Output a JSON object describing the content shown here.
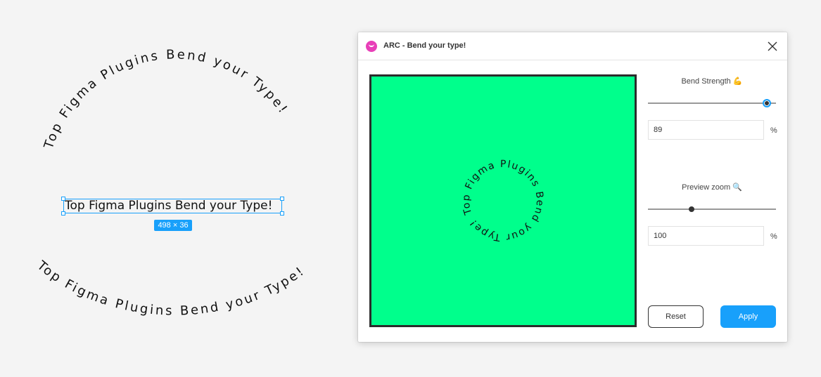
{
  "canvas": {
    "arc_top_text": "Top Figma Plugins Bend your Type!",
    "arc_bottom_text": "Top Figma Plugins Bend your Type!",
    "selected_text": "Top Figma Plugins Bend your Type!",
    "dimensions_badge": "498 × 36"
  },
  "plugin": {
    "title": "ARC - Bend your type!",
    "preview_text": "Top Figma Plugins Bend your Type!",
    "preview_bg": "#00ff8c",
    "bend_strength": {
      "label": "Bend Strength",
      "icon": "flexed-biceps-icon",
      "value": "89",
      "unit": "%",
      "level_percent": 93
    },
    "preview_zoom": {
      "label": "Preview zoom",
      "icon": "magnifier-icon",
      "value": "100",
      "unit": "%",
      "level_percent": 34
    },
    "buttons": {
      "reset": "Reset",
      "apply": "Apply"
    }
  },
  "colors": {
    "accent": "#18a0fb",
    "brand_icon": "#e83fb8"
  }
}
